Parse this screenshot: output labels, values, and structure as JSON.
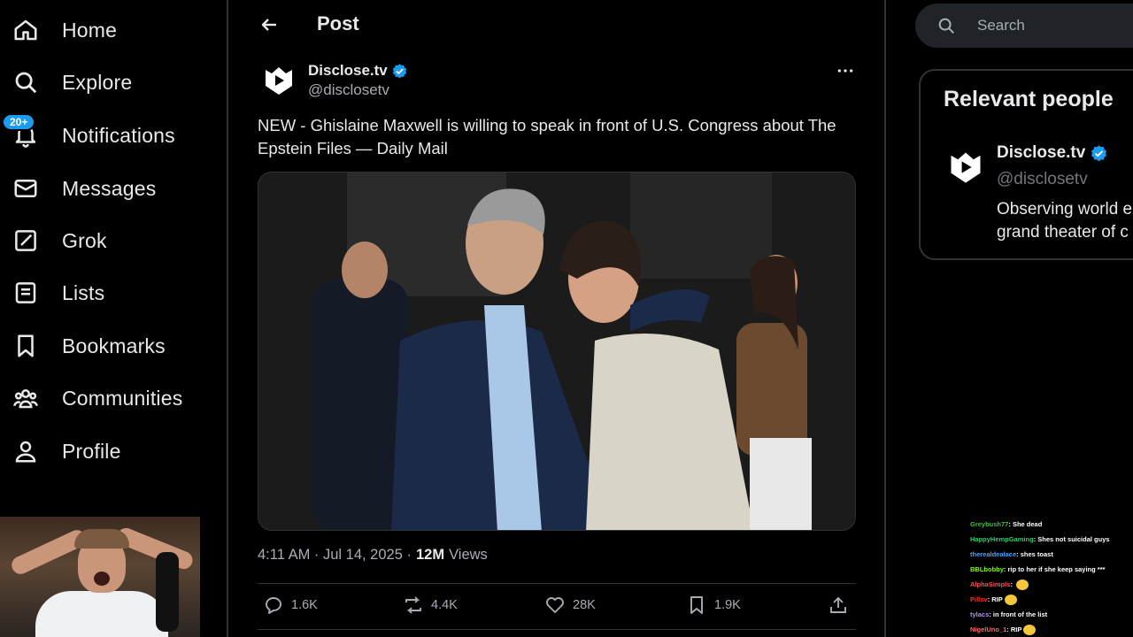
{
  "nav": {
    "items": [
      {
        "label": "Home",
        "icon": "home-icon"
      },
      {
        "label": "Explore",
        "icon": "search-icon"
      },
      {
        "label": "Notifications",
        "icon": "bell-icon",
        "badge": "20+"
      },
      {
        "label": "Messages",
        "icon": "envelope-icon"
      },
      {
        "label": "Grok",
        "icon": "grok-icon"
      },
      {
        "label": "Lists",
        "icon": "list-icon"
      },
      {
        "label": "Bookmarks",
        "icon": "bookmark-icon"
      },
      {
        "label": "Communities",
        "icon": "communities-icon"
      },
      {
        "label": "Profile",
        "icon": "person-icon"
      }
    ]
  },
  "header": {
    "title": "Post"
  },
  "tweet": {
    "author_name": "Disclose.tv",
    "author_handle": "@disclosetv",
    "verified": true,
    "text": "NEW - Ghislaine Maxwell is willing to speak in front of U.S. Congress about The Epstein Files — Daily Mail",
    "time": "4:11 AM · Jul 14, 2025 ·",
    "views_count": "12M",
    "views_label": "Views",
    "replies": "1.6K",
    "reposts": "4.4K",
    "likes": "28K",
    "bookmarks": "1.9K"
  },
  "search": {
    "placeholder": "Search"
  },
  "relevant": {
    "title": "Relevant people",
    "name": "Disclose.tv",
    "handle": "@disclosetv",
    "bio_line1": "Observing world e",
    "bio_line2": "grand theater of c"
  },
  "chat": [
    {
      "user": "Greybush77",
      "msg": "She dead",
      "color": "#3fbf3f"
    },
    {
      "user": "HappyHempGaming",
      "msg": "Shes not suicidal guys",
      "color": "#2ecc71"
    },
    {
      "user": "therealdealace",
      "msg": "shes toast",
      "color": "#4aa3ff"
    },
    {
      "user": "BBLbobby",
      "msg": "rip to her if she keep saying ***",
      "color": "#7cfc00"
    },
    {
      "user": "AlphaSimpls",
      "msg": "",
      "color": "#ff4d4d",
      "emote": true
    },
    {
      "user": "Pillsv",
      "msg": "RIP",
      "color": "#ff3030",
      "emote": true
    },
    {
      "user": "tylacs",
      "msg": "in front of the list",
      "color": "#b58cff"
    },
    {
      "user": "NigelUno_1",
      "msg": "RIP",
      "color": "#ff6a6a",
      "emote": true
    }
  ],
  "colors": {
    "accent": "#1d9bf0",
    "verified": "#1d9bf0",
    "background": "#000000",
    "border": "#2f3336"
  }
}
